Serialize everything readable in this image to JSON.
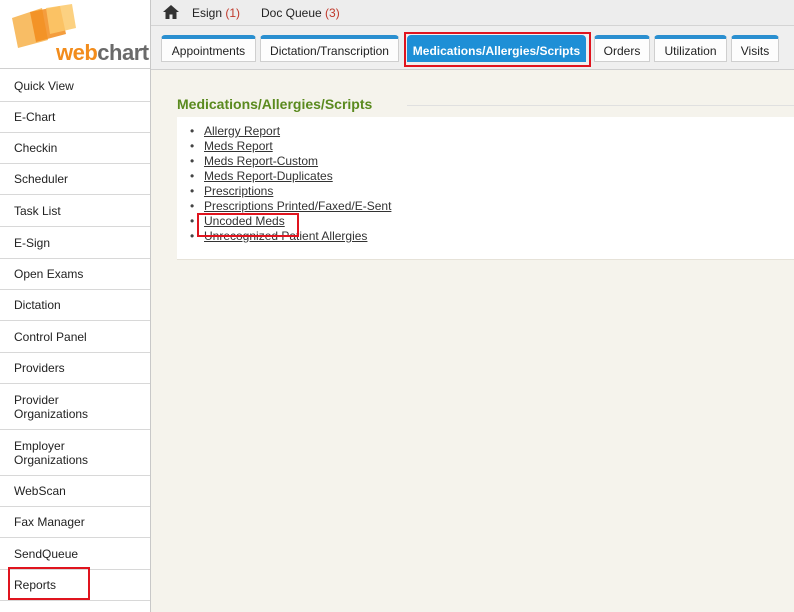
{
  "brand": {
    "logo_text_web": "web",
    "logo_text_chart": "chart",
    "accent_color": "#f28c1c",
    "tab_color": "#1e8fd6",
    "title_color": "#5a8a1e",
    "highlight_color": "#e0141e"
  },
  "topbar": {
    "home_icon": "home-icon",
    "esign_label": "Esign",
    "esign_count": "(1)",
    "docqueue_label": "Doc Queue",
    "docqueue_count": "(3)"
  },
  "tabs": [
    {
      "label": "Appointments",
      "active": false
    },
    {
      "label": "Dictation/Transcription",
      "active": false
    },
    {
      "label": "Medications/Allergies/Scripts",
      "active": true
    },
    {
      "label": "Orders",
      "active": false
    },
    {
      "label": "Utilization",
      "active": false
    },
    {
      "label": "Visits",
      "active": false
    }
  ],
  "sidebar": {
    "items": [
      {
        "label": "Quick View"
      },
      {
        "label": "E-Chart"
      },
      {
        "label": "Checkin"
      },
      {
        "label": "Scheduler"
      },
      {
        "label": "Task List"
      },
      {
        "label": "E-Sign"
      },
      {
        "label": "Open Exams"
      },
      {
        "label": "Dictation"
      },
      {
        "label": "Control Panel"
      },
      {
        "label": "Providers"
      },
      {
        "label": "Provider Organizations"
      },
      {
        "label": "Employer Organizations"
      },
      {
        "label": "WebScan"
      },
      {
        "label": "Fax Manager"
      },
      {
        "label": "SendQueue"
      },
      {
        "label": "Reports"
      }
    ]
  },
  "main": {
    "section_title": "Medications/Allergies/Scripts",
    "bullet": "•",
    "reports": [
      {
        "label": "Allergy Report"
      },
      {
        "label": "Meds Report"
      },
      {
        "label": "Meds Report-Custom"
      },
      {
        "label": "Meds Report-Duplicates"
      },
      {
        "label": "Prescriptions"
      },
      {
        "label": "Prescriptions Printed/Faxed/E-Sent"
      },
      {
        "label": "Uncoded Meds"
      },
      {
        "label": "Unrecognized Patient Allergies"
      }
    ]
  }
}
